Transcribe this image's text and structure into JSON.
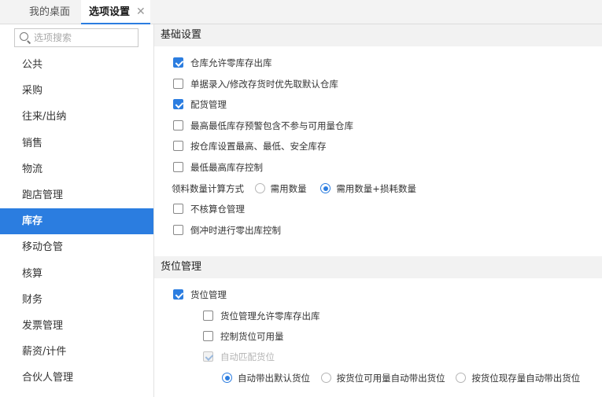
{
  "tabs": [
    {
      "label": "我的桌面"
    },
    {
      "label": "选项设置",
      "close": "✕"
    }
  ],
  "sidebar": {
    "search_placeholder": "选项搜索",
    "items": [
      {
        "label": "公共"
      },
      {
        "label": "采购"
      },
      {
        "label": "往来/出纳"
      },
      {
        "label": "销售"
      },
      {
        "label": "物流"
      },
      {
        "label": "跑店管理"
      },
      {
        "label": "库存"
      },
      {
        "label": "移动仓管"
      },
      {
        "label": "核算"
      },
      {
        "label": "财务"
      },
      {
        "label": "发票管理"
      },
      {
        "label": "薪资/计件"
      },
      {
        "label": "合伙人管理"
      }
    ],
    "active": "库存"
  },
  "basic": {
    "title": "基础设置",
    "options": [
      {
        "label": "仓库允许零库存出库",
        "checked": true
      },
      {
        "label": "单据录入/修改存货时优先取默认仓库",
        "checked": false
      },
      {
        "label": "配货管理",
        "checked": true
      },
      {
        "label": "最高最低库存预警包含不参与可用量仓库",
        "checked": false
      },
      {
        "label": "按仓库设置最高、最低、安全库存",
        "checked": false
      },
      {
        "label": "最低最高库存控制",
        "checked": false
      }
    ],
    "calc": {
      "label": "领料数量计算方式",
      "options": [
        "需用数量",
        "需用数量+损耗数量"
      ],
      "selected": 1
    },
    "options2": [
      {
        "label": "不核算仓管理",
        "checked": false
      },
      {
        "label": "倒冲时进行零出库控制",
        "checked": false
      }
    ]
  },
  "location": {
    "title": "货位管理",
    "main_option": {
      "label": "货位管理",
      "checked": true
    },
    "sub_options": [
      {
        "label": "货位管理允许零库存出库",
        "checked": false
      },
      {
        "label": "控制货位可用量",
        "checked": false
      },
      {
        "label": "自动匹配货位",
        "checked": true,
        "disabled": true
      }
    ],
    "radio": {
      "options": [
        "自动带出默认货位",
        "按货位可用量自动带出货位",
        "按货位现存量自动带出货位"
      ],
      "selected": 0
    }
  }
}
